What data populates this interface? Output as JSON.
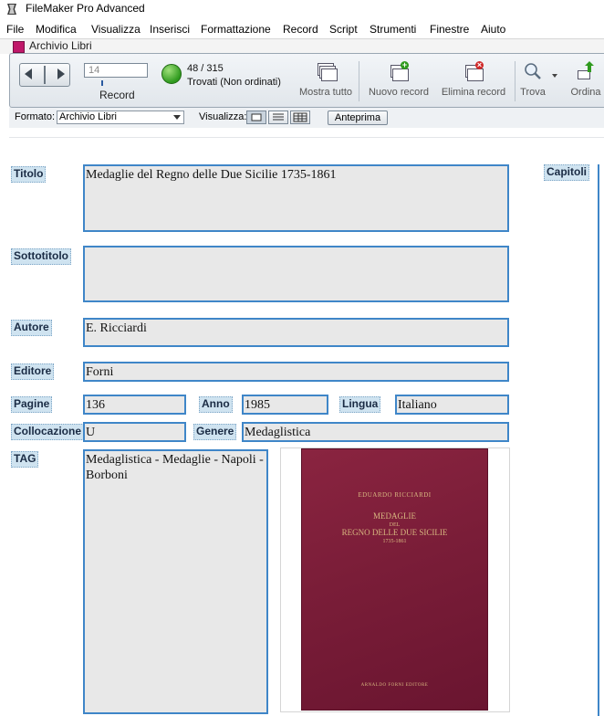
{
  "window": {
    "app_title": "FileMaker Pro Advanced",
    "doc_title": "Archivio Libri"
  },
  "menu": [
    "File",
    "Modifica",
    "Visualizza",
    "Inserisci",
    "Formattazione",
    "Record",
    "Script",
    "Strumenti",
    "Finestre",
    "Aiuto"
  ],
  "toolbar": {
    "record_number": "14",
    "record_label": "Record",
    "found_count": "48 / 315",
    "found_status": "Trovati (Non ordinati)",
    "show_all": "Mostra tutto",
    "new_record": "Nuovo record",
    "delete_record": "Elimina record",
    "find": "Trova",
    "sort": "Ordina"
  },
  "layoutbar": {
    "format_label": "Formato:",
    "format_value": "Archivio Libri",
    "view_label": "Visualizza:",
    "preview": "Anteprima"
  },
  "record": {
    "labels": {
      "titolo": "Titolo",
      "sottotitolo": "Sottotitolo",
      "autore": "Autore",
      "editore": "Editore",
      "pagine": "Pagine",
      "anno": "Anno",
      "lingua": "Lingua",
      "collocazione": "Collocazione",
      "genere": "Genere",
      "tag": "TAG",
      "capitoli": "Capitoli"
    },
    "values": {
      "titolo": "Medaglie del Regno delle Due Sicilie  1735-1861",
      "sottotitolo": "",
      "autore": "E. Ricciardi",
      "editore": "Forni",
      "pagine": "136",
      "anno": "1985",
      "lingua": "Italiano",
      "collocazione": "U",
      "genere": "Medaglistica",
      "tag": "Medaglistica - Medaglie - Napoli - Borboni"
    },
    "cover": {
      "author": "EDUARDO RICCIARDI",
      "title_line1": "MEDAGLIE",
      "title_line2": "DEL",
      "title_line3": "REGNO DELLE DUE SICILIE",
      "title_line4": "1735-1861",
      "publisher": "ARNALDO FORNI EDITORE"
    }
  }
}
